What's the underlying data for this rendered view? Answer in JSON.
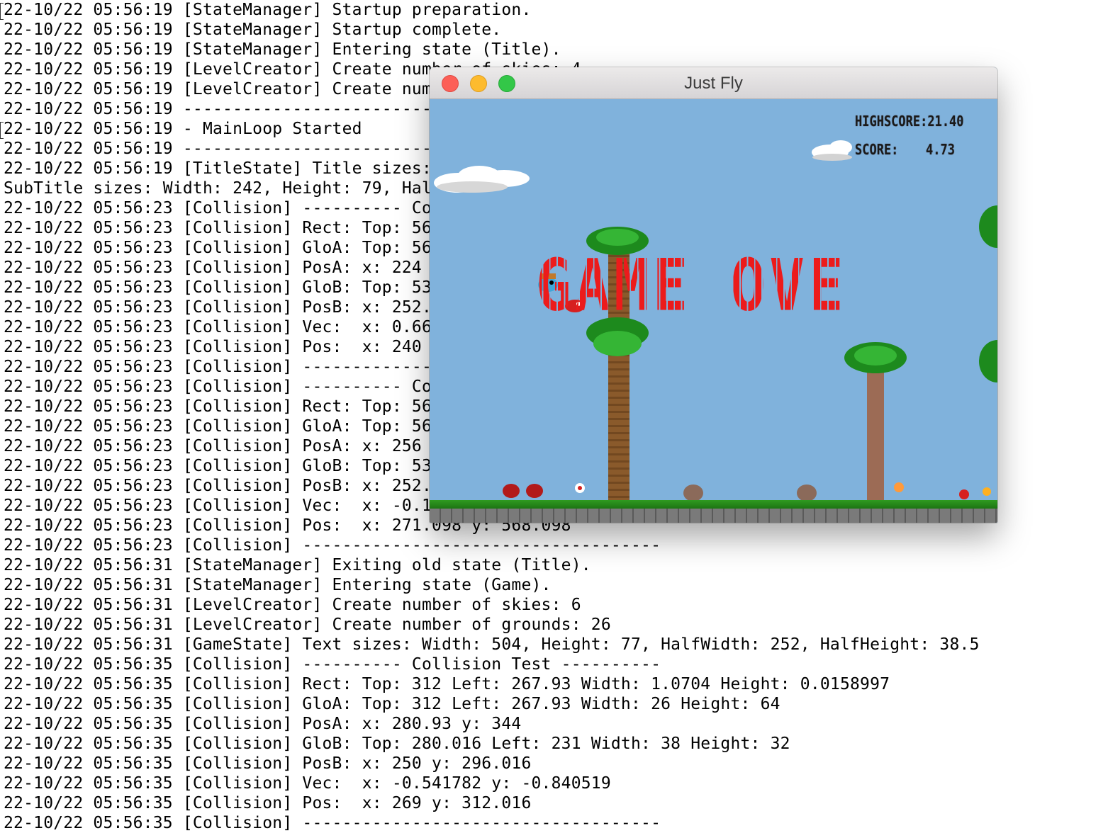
{
  "terminal": {
    "lines": [
      "22-10/22 05:56:19 [StateManager] Startup preparation.",
      "22-10/22 05:56:19 [StateManager] Startup complete.",
      "22-10/22 05:56:19 [StateManager] Entering state (Title).",
      "22-10/22 05:56:19 [LevelCreator] Create number of skies: 4",
      "22-10/22 05:56:19 [LevelCreator] Create num",
      "22-10/22 05:56:19 --------------------------",
      "22-10/22 05:56:19 - MainLoop Started",
      "22-10/22 05:56:19 --------------------------",
      "22-10/22 05:56:19 [TitleState] Title sizes:",
      "SubTitle sizes: Width: 242, Height: 79, Hal",
      "22-10/22 05:56:23 [Collision] ---------- Co",
      "22-10/22 05:56:23 [Collision] Rect: Top: 56",
      "22-10/22 05:56:23 [Collision] GloA: Top: 56",
      "22-10/22 05:56:23 [Collision] PosA: x: 224",
      "22-10/22 05:56:23 [Collision] GloB: Top: 53",
      "22-10/22 05:56:23 [Collision] PosB: x: 252.",
      "22-10/22 05:56:23 [Collision] Vec:  x: 0.66",
      "22-10/22 05:56:23 [Collision] Pos:  x: 240",
      "22-10/22 05:56:23 [Collision] --------------",
      "22-10/22 05:56:23 [Collision] ---------- Co",
      "22-10/22 05:56:23 [Collision] Rect: Top: 56",
      "22-10/22 05:56:23 [Collision] GloA: Top: 56",
      "22-10/22 05:56:23 [Collision] PosA: x: 256",
      "22-10/22 05:56:23 [Collision] GloB: Top: 53",
      "22-10/22 05:56:23 [Collision] PosB: x: 252.",
      "22-10/22 05:56:23 [Collision] Vec:  x: -0.1",
      "22-10/22 05:56:23 [Collision] Pos:  x: 271.098 y: 568.098",
      "22-10/22 05:56:23 [Collision] ------------------------------------",
      "22-10/22 05:56:31 [StateManager] Exiting old state (Title).",
      "22-10/22 05:56:31 [StateManager] Entering state (Game).",
      "22-10/22 05:56:31 [LevelCreator] Create number of skies: 6",
      "22-10/22 05:56:31 [LevelCreator] Create number of grounds: 26",
      "22-10/22 05:56:31 [GameState] Text sizes: Width: 504, Height: 77, HalfWidth: 252, HalfHeight: 38.5",
      "22-10/22 05:56:35 [Collision] ---------- Collision Test ----------",
      "22-10/22 05:56:35 [Collision] Rect: Top: 312 Left: 267.93 Width: 1.0704 Height: 0.0158997",
      "22-10/22 05:56:35 [Collision] GloA: Top: 312 Left: 267.93 Width: 26 Height: 64",
      "22-10/22 05:56:35 [Collision] PosA: x: 280.93 y: 344",
      "22-10/22 05:56:35 [Collision] GloB: Top: 280.016 Left: 231 Width: 38 Height: 32",
      "22-10/22 05:56:35 [Collision] PosB: x: 250 y: 296.016",
      "22-10/22 05:56:35 [Collision] Vec:  x: -0.541782 y: -0.840519",
      "22-10/22 05:56:35 [Collision] Pos:  x: 269 y: 312.016",
      "22-10/22 05:56:35 [Collision] ------------------------------------"
    ]
  },
  "window": {
    "title": "Just Fly",
    "buttons": [
      "close",
      "minimize",
      "zoom"
    ]
  },
  "game": {
    "highscore_label": "HIGHSCORE:21.40",
    "score_label": "SCORE:",
    "score_value": "4.73",
    "game_over_text": "GAME OVER",
    "colors": {
      "sky": "#80b2dc",
      "game_over": "#ec1b1b",
      "grass": "#2f9a20"
    }
  }
}
